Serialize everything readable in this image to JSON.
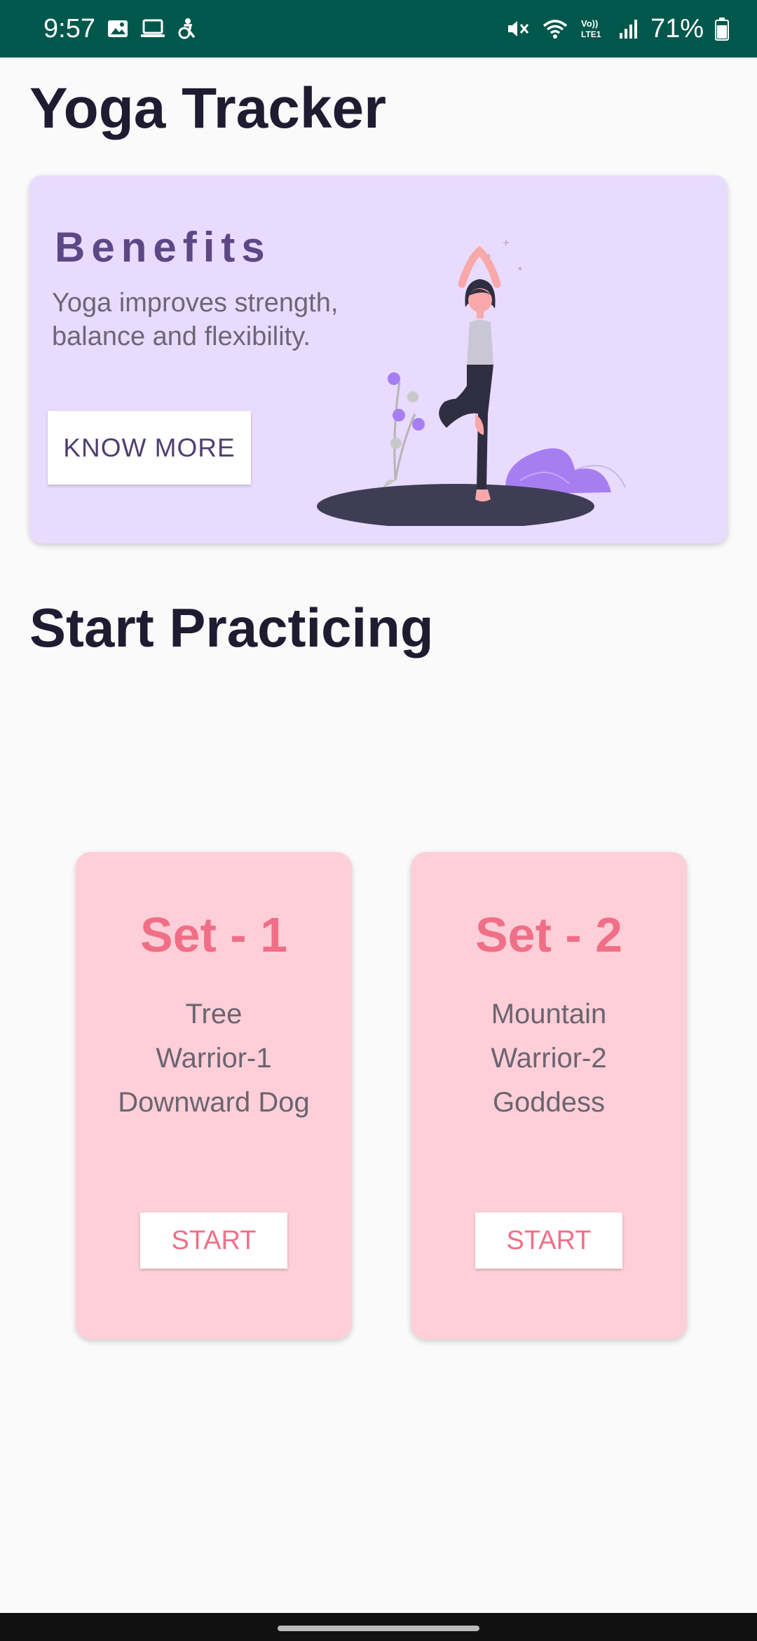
{
  "status_bar": {
    "time": "9:57",
    "battery": "71%",
    "left_icons": [
      "image-icon",
      "laptop-icon",
      "accessibility-icon"
    ],
    "right_icons": [
      "mute-icon",
      "wifi-icon",
      "volte-icon",
      "signal-icon",
      "battery-icon"
    ],
    "background_color": "#00574b"
  },
  "app": {
    "title": "Yoga Tracker"
  },
  "benefits_card": {
    "heading": "Benefits",
    "description": "Yoga improves strength, balance and flexibility.",
    "button_label": "KNOW MORE",
    "background_color": "#e9dbfe",
    "illustration": "woman-tree-pose-illustration"
  },
  "practice_section": {
    "title": "Start Practicing",
    "sets": [
      {
        "title": "Set - 1",
        "poses": [
          "Tree",
          "Warrior-1",
          "Downward Dog"
        ],
        "button_label": "START"
      },
      {
        "title": "Set - 2",
        "poses": [
          "Mountain",
          "Warrior-2",
          "Goddess"
        ],
        "button_label": "START"
      }
    ],
    "card_color": "#fecfd8",
    "accent_color": "#f06f86"
  }
}
